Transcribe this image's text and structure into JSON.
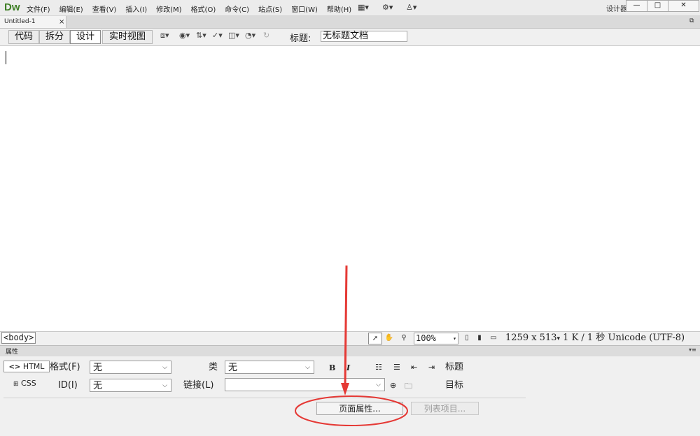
{
  "app": {
    "logo": "Dw",
    "menu": [
      "文件(F)",
      "编辑(E)",
      "查看(V)",
      "插入(I)",
      "修改(M)",
      "格式(O)",
      "命令(C)",
      "站点(S)",
      "窗口(W)",
      "帮助(H)"
    ],
    "workspace_label": "设计器",
    "window_controls": {
      "minimize": "—",
      "maximize": "□",
      "close": "✕"
    }
  },
  "document": {
    "tab_name": "Untitled-1",
    "tab_close": "×",
    "views": [
      "代码",
      "拆分",
      "设计",
      "实时视图"
    ],
    "active_view": "设计",
    "title_label": "标题:",
    "title_value": "无标题文档"
  },
  "statusbar": {
    "tag": "<body>",
    "zoom": "100%",
    "window_size": "1259 x 513",
    "size_time": "1 K / 1 秒",
    "encoding": "Unicode (UTF-8)"
  },
  "properties": {
    "panel_title": "属性",
    "html_btn": "HTML",
    "css_btn": "CSS",
    "format_label": "格式(F)",
    "format_value": "无",
    "id_label": "ID(I)",
    "id_value": "无",
    "class_label": "类",
    "class_value": "无",
    "link_label": "链接(L)",
    "link_value": "",
    "bold": "B",
    "italic": "I",
    "heading_label": "标题",
    "target_label": "目标",
    "page_properties_btn": "页面属性...",
    "list_item_btn": "列表项目..."
  },
  "annotation": {
    "arrow_color": "#e53935",
    "ellipse_color": "#e53935"
  },
  "icons": [
    "window-layout-icon",
    "gear-icon",
    "sync-icon",
    "restore-icon",
    "pointer-icon",
    "hand-icon",
    "zoom-icon",
    "bullet-list-icon",
    "numbered-list-icon",
    "outdent-icon",
    "indent-icon",
    "target-icon",
    "folder-icon"
  ]
}
